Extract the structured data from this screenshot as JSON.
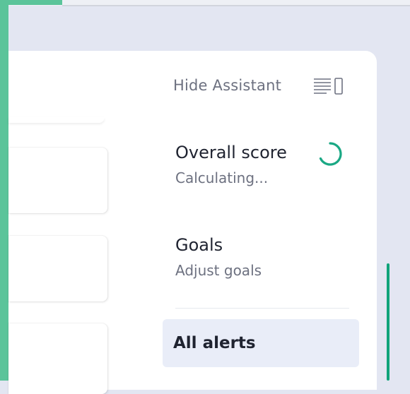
{
  "assistant": {
    "hide_label": "Hide Assistant",
    "hide_icon": "panel-collapse-icon"
  },
  "overall_score": {
    "title": "Overall score",
    "status": "Calculating...",
    "spinner_icon": "loading-spinner-icon"
  },
  "goals": {
    "title": "Goals",
    "action": "Adjust goals"
  },
  "alerts": {
    "label": "All alerts"
  },
  "colors": {
    "accent_green": "#5bc49a",
    "spinner_green": "#1aa884",
    "background": "#e3e6f2",
    "active_item": "#e9edf8"
  }
}
